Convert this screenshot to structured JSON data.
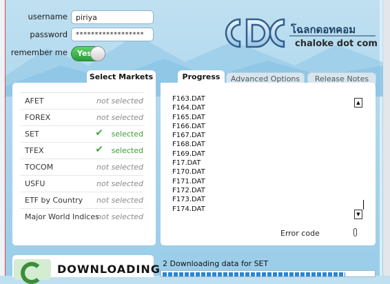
{
  "login": {
    "username_label": "username",
    "username_value": "piriya",
    "password_label": "password",
    "password_value": "******************",
    "remember_label": "remember me",
    "remember_toggle": "Yes"
  },
  "logo": {
    "monogram": "CDC",
    "thai_text": "โฉลกดอทคอม",
    "subtitle": "chaloke dot com"
  },
  "markets": {
    "title": "Select Markets",
    "items": [
      {
        "name": "AFET",
        "status": "not selected",
        "selected": false
      },
      {
        "name": "FOREX",
        "status": "not selected",
        "selected": false
      },
      {
        "name": "SET",
        "status": "selected",
        "selected": true
      },
      {
        "name": "TFEX",
        "status": "selected",
        "selected": true
      },
      {
        "name": "TOCOM",
        "status": "not selected",
        "selected": false
      },
      {
        "name": "USFU",
        "status": "not selected",
        "selected": false
      },
      {
        "name": "ETF by Country",
        "status": "not selected",
        "selected": false
      },
      {
        "name": "Major World Indices",
        "status": "not selected",
        "selected": false
      }
    ]
  },
  "tabs": {
    "progress": "Progress",
    "advanced": "Advanced Options",
    "release": "Release Notes"
  },
  "files": [
    "F163.DAT",
    "F164.DAT",
    "F165.DAT",
    "F166.DAT",
    "F167.DAT",
    "F168.DAT",
    "F169.DAT",
    "F17.DAT",
    "F170.DAT",
    "F171.DAT",
    "F172.DAT",
    "F173.DAT",
    "F174.DAT"
  ],
  "error_label": "Error code",
  "download": {
    "label": "DOWNLOADING...",
    "status_text": "2 Downloading data for SET",
    "progress": 0.86
  },
  "colors": {
    "selected_green": "#3e9b35",
    "progress_blue": "#2a86d6",
    "logo_blue": "#3a7bc0"
  }
}
